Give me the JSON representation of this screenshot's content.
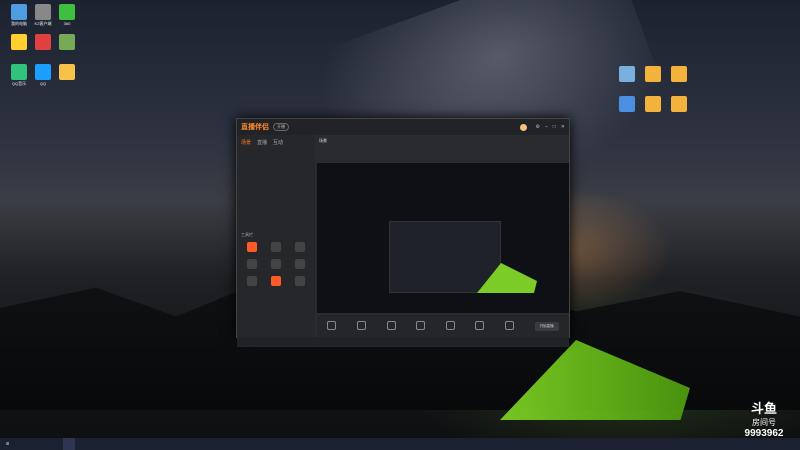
{
  "desktop": {
    "icons_left": [
      {
        "label": "我的电脑",
        "color": "#4d9de0"
      },
      {
        "label": "K2客户端",
        "color": "#888"
      },
      {
        "label": "360",
        "color": "#3fbf3f"
      },
      {
        "label": "",
        "color": "#ffcf30"
      },
      {
        "label": "",
        "color": "#e04040"
      },
      {
        "label": "",
        "color": "#7a5"
      },
      {
        "label": "QQ音乐",
        "color": "#31c27c"
      },
      {
        "label": "QQ",
        "color": "#1aa0ff"
      },
      {
        "label": "",
        "color": "#f6c24a"
      }
    ],
    "icons_right": [
      {
        "label": "",
        "color": "#7ab0e0"
      },
      {
        "label": "",
        "color": "#f3b23c"
      },
      {
        "label": "",
        "color": "#f3b23c"
      },
      {
        "label": "",
        "color": "#4a8fe0"
      },
      {
        "label": "",
        "color": "#f3b23c"
      },
      {
        "label": "",
        "color": "#f3b23c"
      }
    ]
  },
  "app": {
    "logo": "直播伴侣",
    "badge": "开播",
    "tabs": [
      "场景",
      "直播",
      "互动"
    ],
    "scene_rows": [
      "",
      "",
      "",
      "",
      "",
      ""
    ],
    "tools_title": "工具栏",
    "tools": [
      {
        "label": "",
        "orange": true
      },
      {
        "label": "",
        "orange": false
      },
      {
        "label": "",
        "orange": false
      },
      {
        "label": "",
        "orange": false
      },
      {
        "label": "",
        "orange": false
      },
      {
        "label": "",
        "orange": false
      },
      {
        "label": "",
        "orange": false
      },
      {
        "label": "",
        "orange": true
      },
      {
        "label": "",
        "orange": false
      }
    ],
    "scene_label": "场景",
    "controls": [
      {
        "label": ""
      },
      {
        "label": ""
      },
      {
        "label": ""
      },
      {
        "label": ""
      },
      {
        "label": ""
      },
      {
        "label": ""
      },
      {
        "label": ""
      }
    ],
    "start_label": "开始直播",
    "status_text": ""
  },
  "chat": [
    "",
    "",
    "",
    "",
    "",
    "",
    "",
    ""
  ],
  "douyu": {
    "brand": "斗鱼",
    "room_label": "房间号",
    "room_number": "9993962"
  },
  "taskbar": {
    "items": [
      "",
      "",
      "",
      "",
      ""
    ]
  }
}
